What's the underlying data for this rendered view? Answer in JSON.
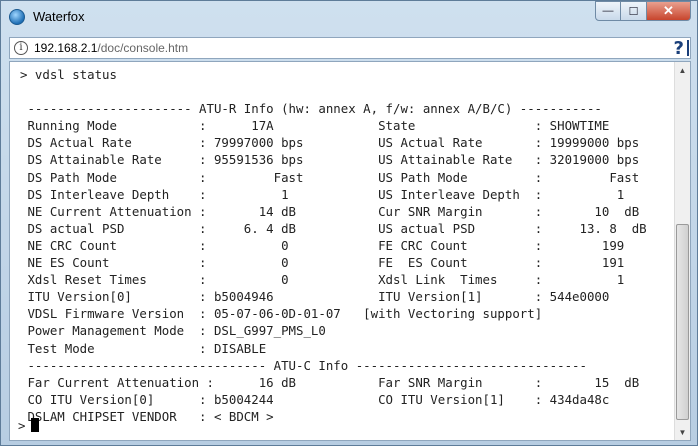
{
  "window": {
    "title": "Waterfox",
    "minimize": "—",
    "maximize": "☐",
    "close": "✕"
  },
  "urlbar": {
    "host": "192.168.2.1",
    "path": "/doc/console.htm"
  },
  "terminal": {
    "lines": [
      "> vdsl status",
      "",
      " ---------------------- ATU-R Info (hw: annex A, f/w: annex A/B/C) -----------",
      " Running Mode           :      17A              State                : SHOWTIME",
      " DS Actual Rate         : 79997000 bps          US Actual Rate       : 19999000 bps",
      " DS Attainable Rate     : 95591536 bps          US Attainable Rate   : 32019000 bps",
      " DS Path Mode           :         Fast          US Path Mode         :         Fast",
      " DS Interleave Depth    :          1            US Interleave Depth  :          1",
      " NE Current Attenuation :       14 dB           Cur SNR Margin       :       10  dB",
      " DS actual PSD          :     6. 4 dB           US actual PSD        :     13. 8  dB",
      " NE CRC Count           :          0            FE CRC Count         :        199",
      " NE ES Count            :          0            FE  ES Count         :        191",
      " Xdsl Reset Times       :          0            Xdsl Link  Times     :          1",
      " ITU Version[0]         : b5004946              ITU Version[1]       : 544e0000",
      " VDSL Firmware Version  : 05-07-06-0D-01-07   [with Vectoring support]",
      " Power Management Mode  : DSL_G997_PMS_L0",
      " Test Mode              : DISABLE",
      " -------------------------------- ATU-C Info -------------------------------",
      " Far Current Attenuation :      16 dB           Far SNR Margin       :       15  dB",
      " CO ITU Version[0]      : b5004244              CO ITU Version[1]    : 434da48c",
      " DSLAM CHIPSET VENDOR   : < BDCM >"
    ],
    "prompt": ">"
  }
}
